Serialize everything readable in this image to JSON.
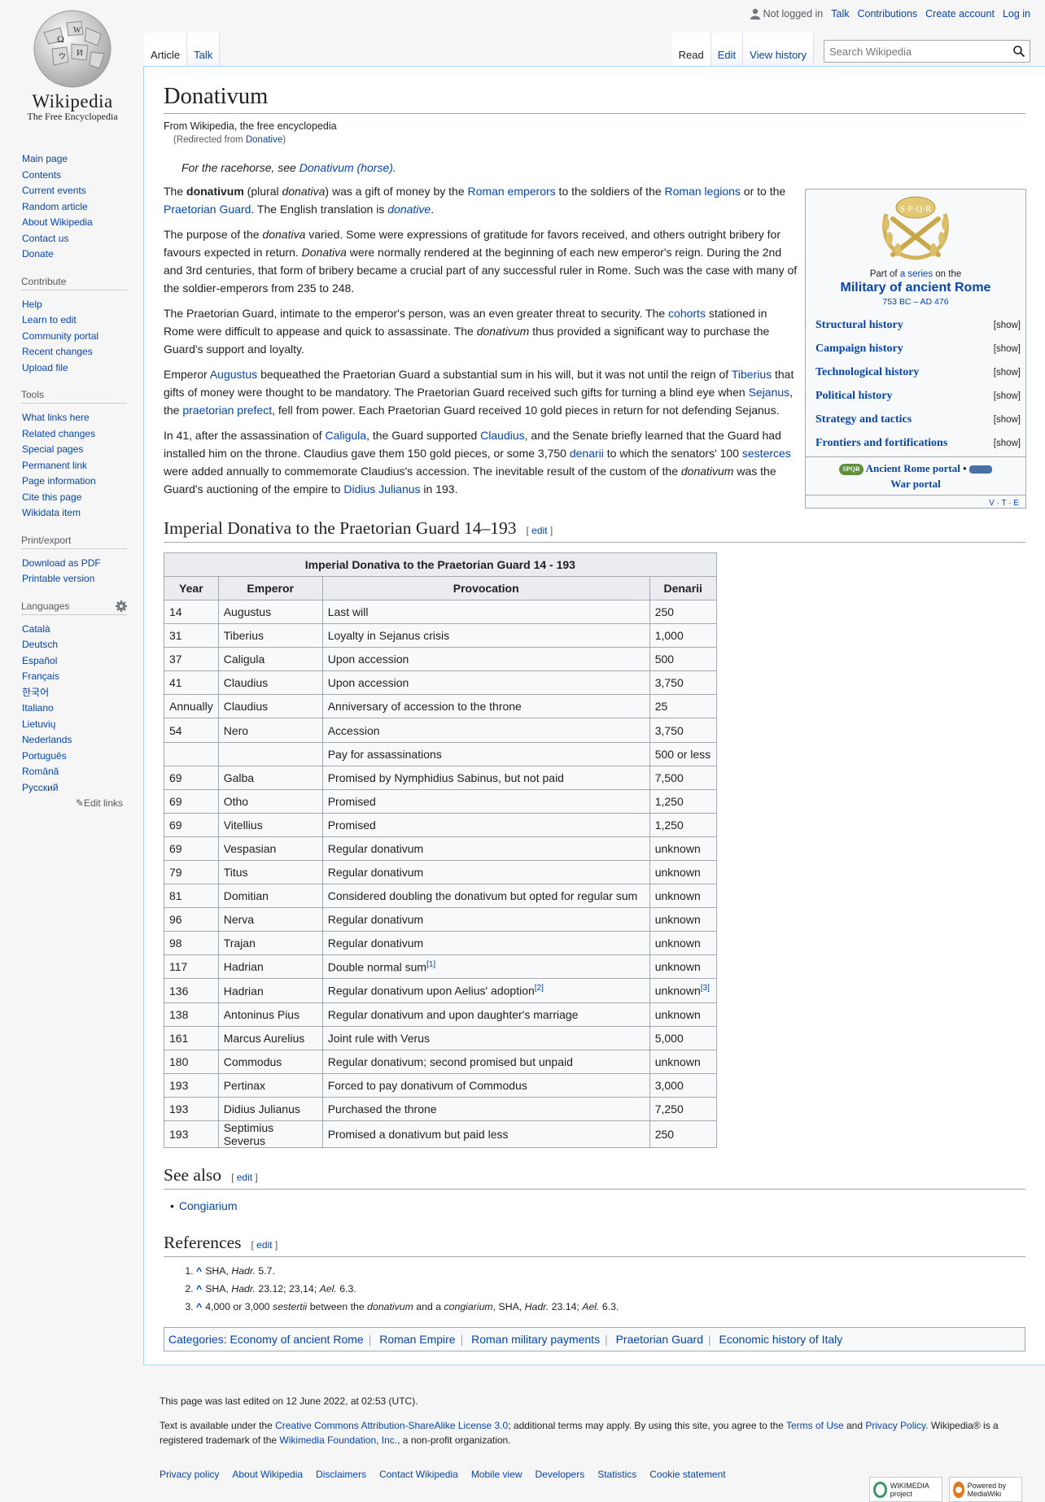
{
  "logo": {
    "wordmark": "Wikipedia",
    "tagline": "The Free Encyclopedia"
  },
  "personal_tools": {
    "not_logged_in": "Not logged in",
    "talk": "Talk",
    "contributions": "Contributions",
    "create_account": "Create account",
    "login": "Log in"
  },
  "tabs": {
    "article": "Article",
    "talk": "Talk",
    "read": "Read",
    "edit": "Edit",
    "view_history": "View history"
  },
  "search": {
    "placeholder": "Search Wikipedia"
  },
  "sidebar": {
    "navigation": [
      "Main page",
      "Contents",
      "Current events",
      "Random article",
      "About Wikipedia",
      "Contact us",
      "Donate"
    ],
    "contribute": {
      "heading": "Contribute",
      "items": [
        "Help",
        "Learn to edit",
        "Community portal",
        "Recent changes",
        "Upload file"
      ]
    },
    "tools": {
      "heading": "Tools",
      "items": [
        "What links here",
        "Related changes",
        "Special pages",
        "Permanent link",
        "Page information",
        "Cite this page",
        "Wikidata item"
      ]
    },
    "print": {
      "heading": "Print/export",
      "items": [
        "Download as PDF",
        "Printable version"
      ]
    },
    "languages": {
      "heading": "Languages",
      "items": [
        "Català",
        "Deutsch",
        "Español",
        "Français",
        "한국어",
        "Italiano",
        "Lietuvių",
        "Nederlands",
        "Português",
        "Română",
        "Русский"
      ],
      "edit_links": "Edit links"
    }
  },
  "article": {
    "title": "Donativum",
    "from": "From Wikipedia, the free encyclopedia",
    "redirected_prefix": "(Redirected from ",
    "redirected_link": "Donative",
    "redirected_suffix": ")",
    "hatnote_prefix": "For the racehorse, see ",
    "hatnote_link": "Donativum (horse)",
    "p1": {
      "a": "The ",
      "b": "donativum",
      "c": " (plural ",
      "d": "donativa",
      "e": ") was a gift of money by the ",
      "l1": "Roman emperors",
      "f": " to the soldiers of the ",
      "l2": "Roman legions",
      "g": " or to the ",
      "l3": "Praetorian Guard",
      "h": ". The English translation is ",
      "l4": "donative",
      "i": "."
    },
    "p2": {
      "a": "The purpose of the ",
      "b": "donativa",
      "c": " varied. Some were expressions of gratitude for favors received, and others outright bribery for favours expected in return. ",
      "d": "Donativa",
      "e": " were normally rendered at the beginning of each new emperor's reign. During the 2nd and 3rd centuries, that form of bribery became a crucial part of any successful ruler in Rome. Such was the case with many of the soldier-emperors from 235 to 248."
    },
    "p3": {
      "a": "The Praetorian Guard, intimate to the emperor's person, was an even greater threat to security. The ",
      "l1": "cohorts",
      "b": " stationed in Rome were difficult to appease and quick to assassinate. The ",
      "c": "donativum",
      "d": " thus provided a significant way to purchase the Guard's support and loyalty."
    },
    "p4": {
      "a": "Emperor ",
      "l1": "Augustus",
      "b": " bequeathed the Praetorian Guard a substantial sum in his will, but it was not until the reign of ",
      "l2": "Tiberius",
      "c": " that gifts of money were thought to be mandatory. The Praetorian Guard received such gifts for turning a blind eye when ",
      "l3": "Sejanus",
      "d": ", the ",
      "l4": "praetorian prefect",
      "e": ", fell from power. Each Praetorian Guard received 10 gold pieces in return for not defending Sejanus."
    },
    "p5": {
      "a": "In 41, after the assassination of ",
      "l1": "Caligula",
      "b": ", the Guard supported ",
      "l2": "Claudius",
      "c": ", and the Senate briefly learned that the Guard had installed him on the throne. Claudius gave them 150 gold pieces, or some 3,750 ",
      "l3": "denarii",
      "d": " to which the senators' 100 ",
      "l4": "sesterces",
      "e": " were added annually to commemorate Claudius's accession. The inevitable result of the custom of the ",
      "f": "donativum",
      "g": " was the Guard's auctioning of the empire to ",
      "l5": "Didius Julianus",
      "h": " in 193."
    }
  },
  "infobox": {
    "part_of_a": "Part of ",
    "part_of_link": "a series",
    "part_of_b": " on the",
    "series": "Military of ancient Rome",
    "dates": "753 BC – AD 476",
    "rows": [
      {
        "title": "Structural history",
        "action": "[show]"
      },
      {
        "title": "Campaign history",
        "action": "[show]"
      },
      {
        "title": "Technological history",
        "action": "[show]"
      },
      {
        "title": "Political history",
        "action": "[show]"
      },
      {
        "title": "Strategy and tactics",
        "action": "[show]"
      },
      {
        "title": "Frontiers and fortifications",
        "action": "[show]"
      }
    ],
    "portal1": "Ancient Rome portal",
    "portal_sep": " •",
    "portal2": "War portal",
    "vte": "V · T · E",
    "spqr": "S·P·Q·R"
  },
  "section1": {
    "heading": "Imperial Donativa to the Praetorian Guard 14–193",
    "edit": "edit"
  },
  "table": {
    "caption": "Imperial Donativa to the Praetorian Guard 14 - 193",
    "headers": [
      "Year",
      "Emperor",
      "Provocation",
      "Denarii"
    ],
    "rows": [
      [
        "14",
        "Augustus",
        "Last will",
        "250"
      ],
      [
        "31",
        "Tiberius",
        "Loyalty in Sejanus crisis",
        "1,000"
      ],
      [
        "37",
        "Caligula",
        "Upon accession",
        "500"
      ],
      [
        "41",
        "Claudius",
        "Upon accession",
        "3,750"
      ],
      [
        "Annually",
        "Claudius",
        "Anniversary of accession to the throne",
        "25"
      ],
      [
        "54",
        "Nero",
        "Accession",
        "3,750"
      ],
      [
        "",
        "",
        "Pay for assassinations",
        "500 or less"
      ],
      [
        "69",
        "Galba",
        "Promised by Nymphidius Sabinus, but not paid",
        "7,500"
      ],
      [
        "69",
        "Otho",
        "Promised",
        "1,250"
      ],
      [
        "69",
        "Vitellius",
        "Promised",
        "1,250"
      ],
      [
        "69",
        "Vespasian",
        "Regular donativum",
        "unknown"
      ],
      [
        "79",
        "Titus",
        "Regular donativum",
        "unknown"
      ],
      [
        "81",
        "Domitian",
        "Considered doubling the donativum but opted for regular sum",
        "unknown"
      ],
      [
        "96",
        "Nerva",
        "Regular donativum",
        "unknown"
      ],
      [
        "98",
        "Trajan",
        "Regular donativum",
        "unknown"
      ],
      [
        "117",
        "Hadrian",
        "Double normal sum",
        "unknown"
      ],
      [
        "136",
        "Hadrian",
        "Regular donativum upon Aelius' adoption",
        "unknown"
      ],
      [
        "138",
        "Antoninus Pius",
        "Regular donativum and upon daughter's marriage",
        "unknown"
      ],
      [
        "161",
        "Marcus Aurelius",
        "Joint rule with Verus",
        "5,000"
      ],
      [
        "180",
        "Commodus",
        "Regular donativum; second promised but unpaid",
        "unknown"
      ],
      [
        "193",
        "Pertinax",
        "Forced to pay donativum of Commodus",
        "3,000"
      ],
      [
        "193",
        "Didius Julianus",
        "Purchased the throne",
        "7,250"
      ],
      [
        "193",
        "Septimius Severus",
        "Promised a donativum but paid less",
        "250"
      ]
    ],
    "ref1": "[1]",
    "ref2": "[2]",
    "ref3": "[3]"
  },
  "see_also": {
    "heading": "See also",
    "edit": "edit",
    "items": [
      "Congiarium"
    ]
  },
  "references": {
    "heading": "References",
    "edit": "edit",
    "r1": {
      "a": "SHA, ",
      "b": "Hadr.",
      "c": " 5.7."
    },
    "r2": {
      "a": "SHA, ",
      "b": "Hadr.",
      "c": " 23.12; 23,14; ",
      "d": "Ael.",
      "e": " 6.3."
    },
    "r3": {
      "a": "4,000 or 3,000 ",
      "b": "sestertii",
      "c": " between the ",
      "d": "donativum",
      "e": " and a ",
      "f": "congiarium",
      "g": ", SHA, ",
      "h": "Hadr.",
      "i": " 23.14; ",
      "j": "Ael.",
      "k": " 6.3."
    }
  },
  "categories": {
    "label": "Categories",
    "items": [
      "Economy of ancient Rome",
      "Roman Empire",
      "Roman military payments",
      "Praetorian Guard",
      "Economic history of Italy"
    ]
  },
  "footer": {
    "last_edited": "This page was last edited on 12 June 2022, at 02:53 (UTC).",
    "lic_a": "Text is available under the ",
    "lic_l1": "Creative Commons Attribution-ShareAlike License 3.0",
    "lic_b": "; additional terms may apply. By using this site, you agree to the ",
    "lic_l2": "Terms of Use",
    "lic_c": " and ",
    "lic_l3": "Privacy Policy",
    "lic_d": ". Wikipedia® is a registered trademark of the ",
    "lic_l4": "Wikimedia Foundation, Inc.",
    "lic_e": ", a non-profit organization.",
    "links": [
      "Privacy policy",
      "About Wikipedia",
      "Disclaimers",
      "Contact Wikipedia",
      "Mobile view",
      "Developers",
      "Statistics",
      "Cookie statement"
    ],
    "badge1": "WIKIMEDIA project",
    "badge2": "Powered by MediaWiki"
  }
}
